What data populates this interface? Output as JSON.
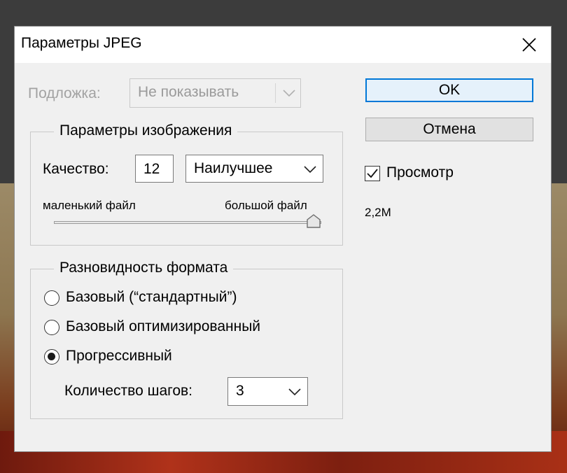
{
  "dialog": {
    "title": "Параметры JPEG"
  },
  "matte": {
    "label": "Подложка:",
    "value": "Не показывать"
  },
  "image_options": {
    "group_title": "Параметры изображения",
    "quality_label": "Качество:",
    "quality_value": "12",
    "quality_preset": "Наилучшее",
    "small_file_label": "маленький файл",
    "large_file_label": "большой файл",
    "slider_level": 12,
    "slider_max": 12
  },
  "format_options": {
    "group_title": "Разновидность формата",
    "options": [
      {
        "label": "Базовый (“стандартный”)",
        "checked": false
      },
      {
        "label": "Базовый оптимизированный",
        "checked": false
      },
      {
        "label": "Прогрессивный",
        "checked": true
      }
    ],
    "scans_label": "Количество шагов:",
    "scans_value": "3"
  },
  "buttons": {
    "ok": "OK",
    "cancel": "Отмена"
  },
  "preview": {
    "label": "Просмотр",
    "checked": true,
    "file_size": "2,2M"
  },
  "colors": {
    "accent": "#0078d7",
    "dialog_bg": "#f0f0f0",
    "disabled_text": "#a2a2a2"
  }
}
